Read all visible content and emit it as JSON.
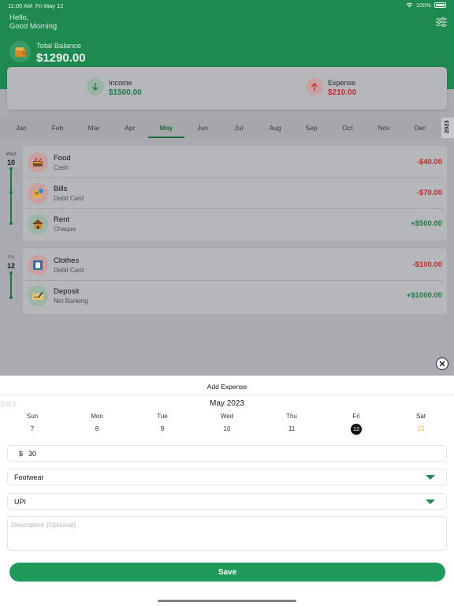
{
  "status_bar": {
    "time": "11:00 AM",
    "date": "Fri May 12",
    "battery": "100%"
  },
  "greeting": {
    "line1": "Hello,",
    "line2": "Good Morning"
  },
  "balance": {
    "label": "Total Balance",
    "value": "$1290.00"
  },
  "summary": {
    "income": {
      "label": "Income",
      "value": "$1500.00"
    },
    "expense": {
      "label": "Expense",
      "value": "$210.00"
    }
  },
  "months": [
    "Jan",
    "Feb",
    "Mar",
    "Apr",
    "May",
    "Jun",
    "Jul",
    "Aug",
    "Sep",
    "Oct",
    "Nov",
    "Dec"
  ],
  "active_month": "May",
  "year": "2023",
  "transaction_groups": [
    {
      "day_name": "Wed",
      "day_num": "10",
      "items": [
        {
          "name": "Food",
          "method": "Cash",
          "amount": "-$40.00",
          "type": "expense",
          "icon": "food-icon"
        },
        {
          "name": "Bills",
          "method": "Debit Card",
          "amount": "-$70.00",
          "type": "expense",
          "icon": "bills-icon"
        },
        {
          "name": "Rent",
          "method": "Cheque",
          "amount": "+$500.00",
          "type": "income",
          "icon": "house-icon"
        }
      ]
    },
    {
      "day_name": "Fri",
      "day_num": "12",
      "items": [
        {
          "name": "Clothes",
          "method": "Debit Card",
          "amount": "-$100.00",
          "type": "expense",
          "icon": "shirt-icon"
        },
        {
          "name": "Deposit",
          "method": "Net Banking",
          "amount": "+$1000.00",
          "type": "income",
          "icon": "cheque-icon"
        }
      ]
    }
  ],
  "add_expense": {
    "title": "Add Expense",
    "calendar": {
      "prev_year": "2023",
      "month_label": "May 2023",
      "weekdays": [
        "Sun",
        "Mon",
        "Tue",
        "Wed",
        "Thu",
        "Fri",
        "Sat"
      ],
      "days": [
        "7",
        "8",
        "9",
        "10",
        "11",
        "12",
        "15"
      ],
      "selected_index": 5,
      "weekend_index": 6
    },
    "currency_symbol": "$",
    "amount": "30",
    "category": "Footwear",
    "payment_method": "UPI",
    "description_placeholder": "Description (Optional)",
    "save_label": "Save"
  },
  "colors": {
    "brand_green": "#1f9a5c",
    "expense_red": "#c42b2b",
    "income_green": "#1e7a46",
    "weekend_yellow": "#f0b429"
  }
}
